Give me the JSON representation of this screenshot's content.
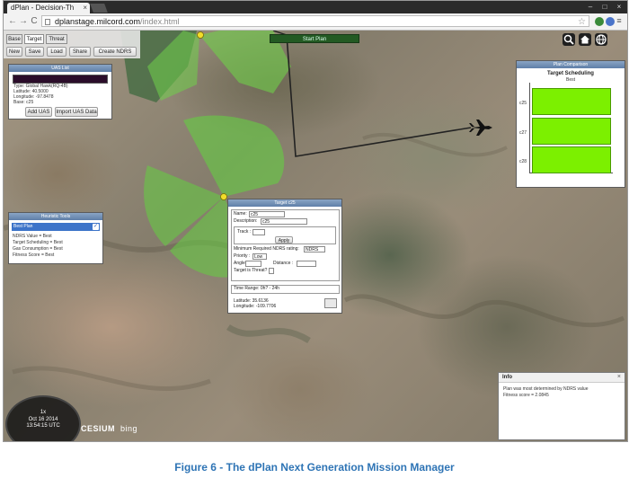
{
  "browser": {
    "tab_title": "dPlan - Decision-Th",
    "tab_close": "×",
    "url_host": "dplanstage.milcord.com",
    "url_path": "/index.html",
    "window_controls": [
      "–",
      "□",
      "×"
    ],
    "menu_glyph": "≡",
    "back_glyph": "←",
    "forward_glyph": "→",
    "reload_glyph": "C",
    "star_glyph": "☆"
  },
  "app": {
    "tabs": [
      "Base",
      "Target",
      "Threat"
    ],
    "active_tab": "Target",
    "toolbar_buttons": [
      "New",
      "Save",
      "Load",
      "Share",
      "Create NDRS"
    ],
    "start_plan_label": "Start Plan",
    "right_icons": [
      "search-icon",
      "home-icon",
      "globe-icon"
    ]
  },
  "uav_panel": {
    "title": "UAS List",
    "type_line": "Type: Global Hawk(RQ-4B)",
    "latitude_line": "Latitude: 40.5000",
    "longitude_line": "Longitude: -97.8478",
    "base_line": "Base: c25",
    "add_button": "Add UAS",
    "import_button": "Import UAS Data"
  },
  "heuristic_panel": {
    "title": "Heuristic Tools",
    "selected_item": "Best Plan",
    "lines": [
      "NDRS Value = Best",
      "Target Scheduling = Best",
      "Gas Consumption = Best",
      "Fitness Score = Best"
    ]
  },
  "target_panel": {
    "title": "Target c25",
    "name_label": "Name:",
    "name_value": "c25",
    "desc_label": "Description:",
    "desc_value": "c25",
    "track_label": "Track :",
    "apply_button": "Apply",
    "min_ndrs_label": "Minimum Required NDRS rating:",
    "min_ndrs_value": "NDRS",
    "priority_label": "Priority :",
    "priority_value": "Low",
    "angle_label": "Angle :",
    "distance_label": "Distance :",
    "threat_label": "Target is Threat?",
    "time_range_label": "Time Range: 0h? - 24h",
    "latitude_line": "Latitude: 35.6136",
    "longitude_line": "Longitude: -109.7706"
  },
  "plan_panel": {
    "title": "Plan Comparison",
    "chart_title": "Target Scheduling",
    "chart_subtitle": "Best",
    "row_labels": [
      "c25",
      "c27",
      "c28"
    ],
    "bar_color": "#7cf000"
  },
  "info_panel": {
    "title": "Info",
    "close": "×",
    "line1": "Plan was most determined by NDRS value",
    "line2": "Fitness score = 2.0845"
  },
  "clock": {
    "speed": "1x",
    "date": "Oct 16 2014",
    "time": "13:54:15 UTC"
  },
  "credits": {
    "cesium": "CESIUM",
    "bing": "bing"
  },
  "caption": "Figure 6 - The dPlan Next Generation Mission Manager"
}
